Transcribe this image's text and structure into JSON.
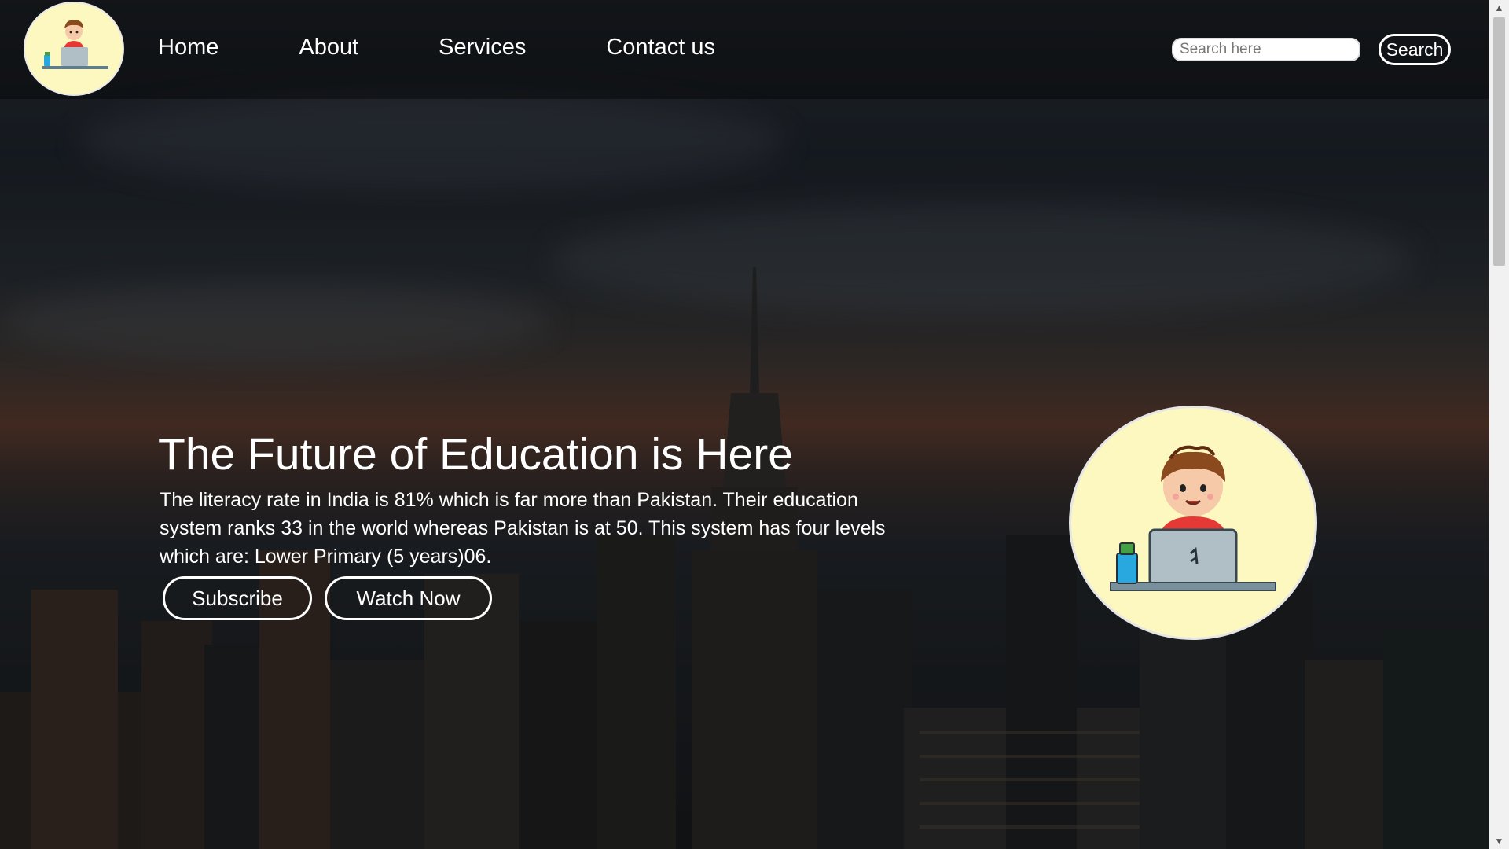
{
  "nav": {
    "logo_icon": "boy-at-laptop-icon",
    "links": [
      "Home",
      "About",
      "Services",
      "Contact us"
    ],
    "search_placeholder": "Search here",
    "search_button": "Search"
  },
  "hero": {
    "title": "The Future of Education is Here",
    "description": "The literacy rate in India is 81% which is far more than Pakistan. Their education system ranks 33 in the world whereas Pakistan is at 50. This system has four levels which are: Lower Primary (5 years)06.",
    "subscribe_label": "Subscribe",
    "watch_label": "Watch Now",
    "illustration_icon": "boy-at-laptop-icon"
  },
  "colors": {
    "illustration_bg": "#fdf7c0",
    "button_border": "#ffffff"
  },
  "scrollbar": {
    "up_icon": "▲",
    "down_icon": "▼"
  }
}
